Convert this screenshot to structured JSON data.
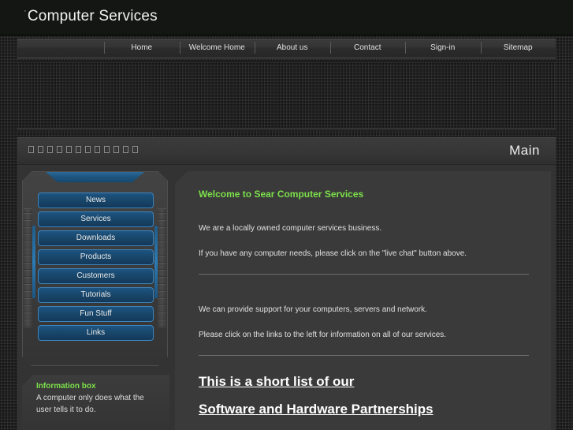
{
  "header": {
    "bullet": "·",
    "title": "Computer Services"
  },
  "nav": {
    "items": [
      {
        "label": "Home"
      },
      {
        "label": "Welcome Home"
      },
      {
        "label": "About us"
      },
      {
        "label": "Contact"
      },
      {
        "label": "Sign-in"
      },
      {
        "label": "Sitemap"
      }
    ]
  },
  "content_header": {
    "glyph_count": 12,
    "glyph_name": "missing-glyph-box",
    "section_label": "Main"
  },
  "sidebar": {
    "items": [
      {
        "label": "News"
      },
      {
        "label": "Services"
      },
      {
        "label": "Downloads"
      },
      {
        "label": "Products"
      },
      {
        "label": "Customers"
      },
      {
        "label": "Tutorials"
      },
      {
        "label": "Fun Stuff"
      },
      {
        "label": "Links"
      }
    ]
  },
  "info_box": {
    "title": "Information box",
    "text": "A computer only does what the user tells it to do."
  },
  "main": {
    "welcome_heading": "Welcome to Sear Computer Services",
    "para1": "We are a locally owned computer services business.",
    "para2": "If you have any computer needs, please click on the \"live chat\" button above.",
    "para3": "We can provide support for your computers, servers and network.",
    "para4": "Please click on the links to the left for information on all of our services.",
    "heading1": "This is a short list of our",
    "heading2": "Software and Hardware Partnerships"
  },
  "colors": {
    "page_bg": "#2e2e2e",
    "header_bg": "#141613",
    "panel_bg": "#3a3a3a",
    "accent_green": "#7ce04a",
    "accent_blue": "#1d5481",
    "button_border_blue": "#3d84bb",
    "text": "#e0e0e0"
  }
}
